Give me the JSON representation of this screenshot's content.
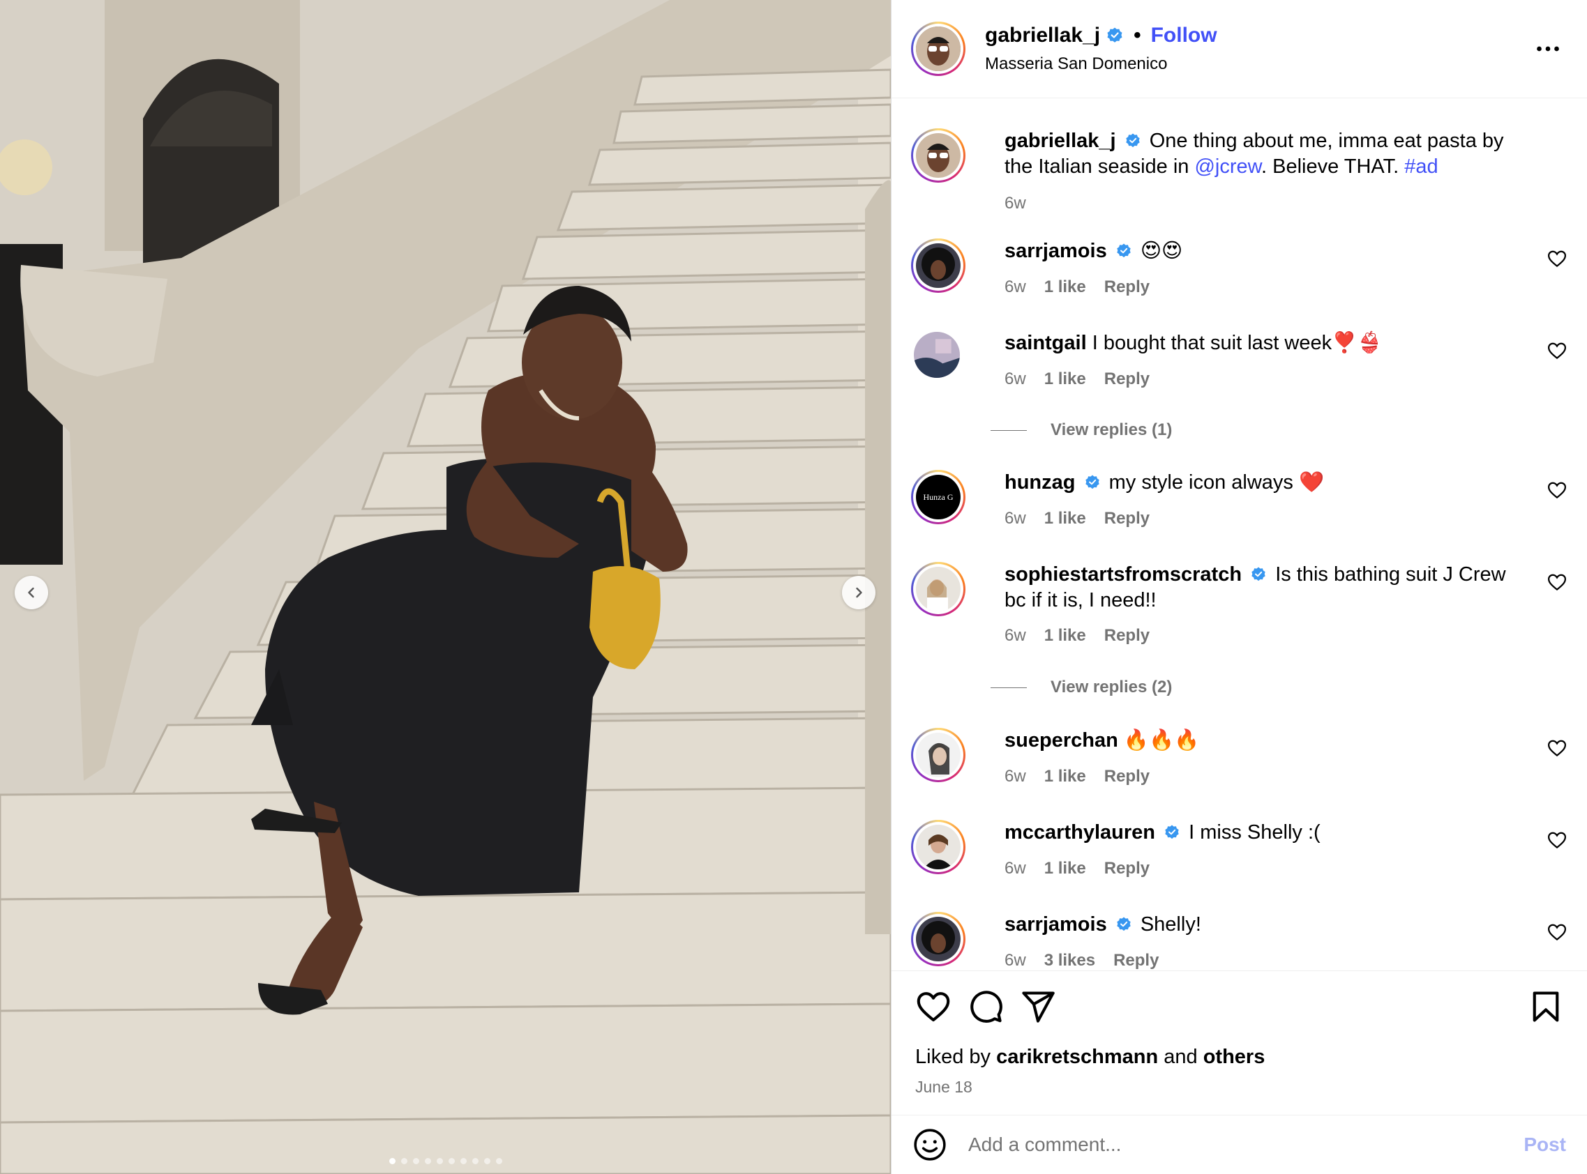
{
  "post": {
    "author": "gabriellak_j",
    "follow_label": "Follow",
    "separator": "•",
    "location": "Masseria San Domenico"
  },
  "caption": {
    "username": "gabriellak_j",
    "text_1": "One thing about me, imma eat pasta by the Italian seaside in ",
    "mention": "@jcrew",
    "text_2": ". Believe THAT. ",
    "hashtag": "#ad",
    "time": "6w"
  },
  "comments": [
    {
      "username": "sarrjamois",
      "verified": true,
      "text": "😍😍",
      "time": "6w",
      "likes": "1 like",
      "reply": "Reply"
    },
    {
      "username": "saintgail",
      "verified": false,
      "text": "I bought that suit last week❣️👙",
      "time": "6w",
      "likes": "1 like",
      "reply": "Reply",
      "replies": "View replies (1)"
    },
    {
      "username": "hunzag",
      "verified": true,
      "text": "my style icon always ❤️",
      "time": "6w",
      "likes": "1 like",
      "reply": "Reply",
      "avatar_text": "Hunza G"
    },
    {
      "username": "sophiestartsfromscratch",
      "verified": true,
      "text": "Is this bathing suit J Crew bc if it is, I need!!",
      "time": "6w",
      "likes": "1 like",
      "reply": "Reply",
      "replies": "View replies (2)"
    },
    {
      "username": "sueperchan",
      "verified": false,
      "text": "🔥🔥🔥",
      "time": "6w",
      "likes": "1 like",
      "reply": "Reply"
    },
    {
      "username": "mccarthylauren",
      "verified": true,
      "text": "I miss Shelly :(",
      "time": "6w",
      "likes": "1 like",
      "reply": "Reply"
    },
    {
      "username": "sarrjamois",
      "verified": true,
      "text": "Shelly!",
      "time": "6w",
      "likes": "3 likes",
      "reply": "Reply"
    }
  ],
  "likes": {
    "prefix": "Liked by ",
    "user": "carikretschmann",
    "and": " and ",
    "others": "others"
  },
  "date": "June 18",
  "composer": {
    "placeholder": "Add a comment...",
    "post_label": "Post"
  },
  "icons": {
    "verified": "verified-badge-icon",
    "more": "more-options-icon",
    "like": "heart-icon",
    "comment": "comment-bubble-icon",
    "share": "paper-plane-icon",
    "save": "bookmark-icon",
    "emoji": "emoji-smile-icon",
    "prev": "chevron-left-icon",
    "next": "chevron-right-icon"
  },
  "colors": {
    "link": "#4150f7",
    "secondary_text": "#737373",
    "verified": "#3897f0",
    "divider": "#efefef"
  },
  "carousel": {
    "slides": 10,
    "active": 1
  }
}
